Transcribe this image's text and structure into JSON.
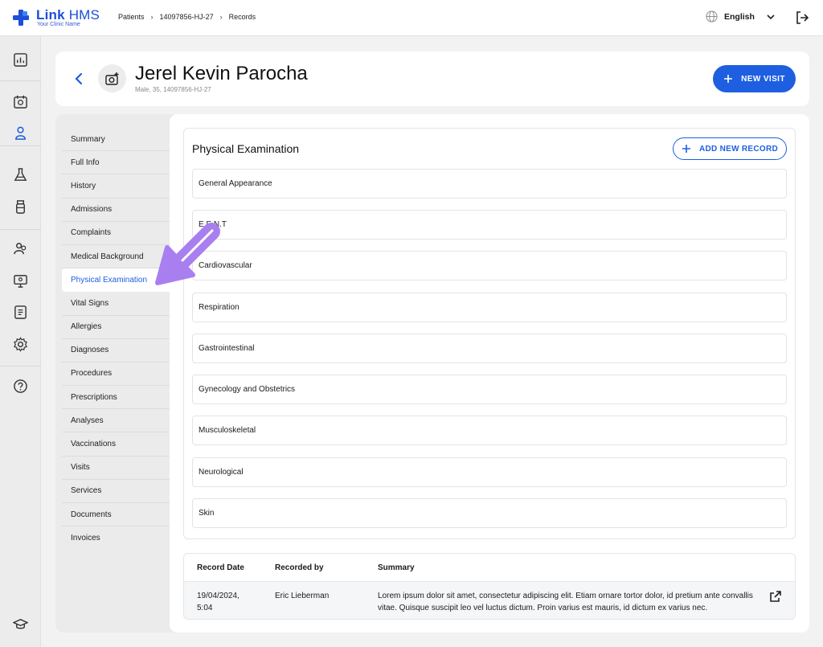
{
  "app": {
    "brand_bold": "Link",
    "brand_regular": "HMS",
    "clinic_name": "Your Clinic Name"
  },
  "breadcrumb": [
    "Patients",
    "14097856-HJ-27",
    "Records"
  ],
  "language": "English",
  "rail_icons": [
    "dashboard-icon",
    "calendar-icon",
    "patient-icon",
    "lab-flask-icon",
    "medicine-bottle-icon",
    "staff-icon",
    "monitor-icon",
    "report-icon",
    "settings-gear-icon",
    "help-icon",
    "education-cap-icon"
  ],
  "patient": {
    "name": "Jerel Kevin Parocha",
    "details": "Male, 35, 14097856-HJ-27"
  },
  "actions": {
    "new_visit": "NEW VISIT",
    "add_new_record": "ADD NEW RECORD"
  },
  "submenu": [
    "Summary",
    "Full Info",
    "History",
    "Admissions",
    "Complaints",
    "Medical Background",
    "Physical Examination",
    "Vital Signs",
    "Allergies",
    "Diagnoses",
    "Procedures",
    "Prescriptions",
    "Analyses",
    "Vaccinations",
    "Visits",
    "Services",
    "Documents",
    "Invoices"
  ],
  "active_submenu": "Physical Examination",
  "exam": {
    "title": "Physical Examination",
    "sections": [
      "General Appearance",
      "E.E.N.T",
      "Cardiovascular",
      "Respiration",
      "Gastrointestinal",
      "Gynecology and Obstetrics",
      "Musculoskeletal",
      "Neurological",
      "Skin"
    ]
  },
  "table": {
    "headers": [
      "Record Date",
      "Recorded by",
      "Summary"
    ],
    "rows": [
      {
        "date_line1": "19/04/2024,",
        "date_line2": "5:04",
        "recorded_by": "Eric Lieberman",
        "summary": "Lorem ipsum dolor sit amet, consectetur adipiscing elit. Etiam ornare tortor dolor, id pretium ante convallis vitae. Quisque suscipit leo vel luctus dictum. Proin varius est mauris, id dictum ex varius nec."
      }
    ]
  },
  "colors": {
    "primary": "#1d5fe0",
    "annotation": "#a97ff0"
  }
}
